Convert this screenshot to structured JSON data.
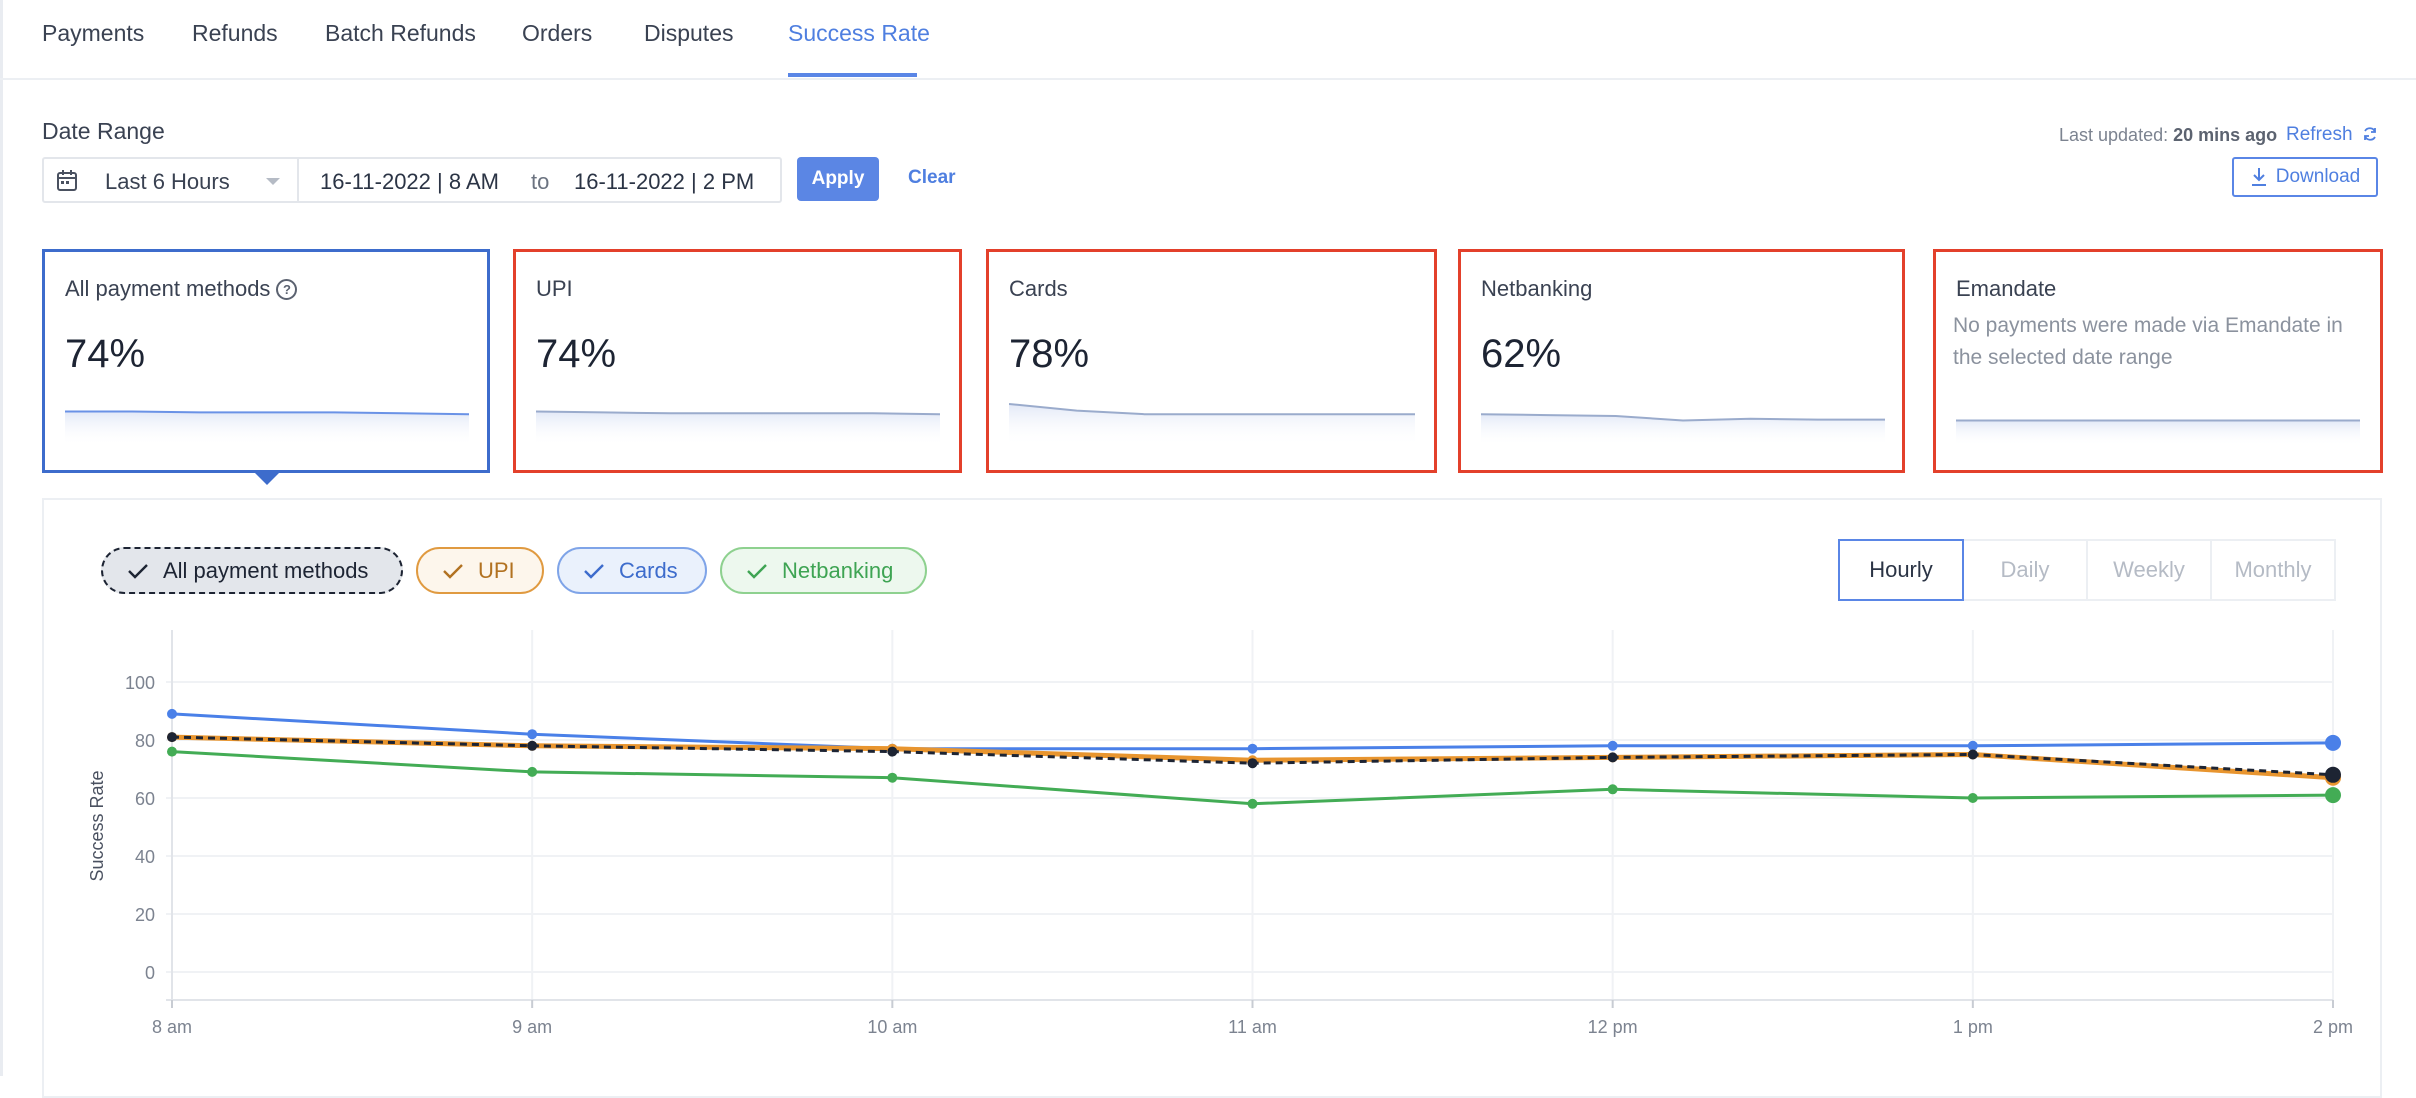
{
  "tabs": [
    {
      "label": "Payments"
    },
    {
      "label": "Refunds"
    },
    {
      "label": "Batch Refunds"
    },
    {
      "label": "Orders"
    },
    {
      "label": "Disputes"
    },
    {
      "label": "Success Rate",
      "active": true
    }
  ],
  "date_range": {
    "label": "Date Range",
    "preset": "Last 6 Hours",
    "from": "16-11-2022 | 8 AM",
    "to_label": "to",
    "to": "16-11-2022 | 2 PM",
    "apply_label": "Apply",
    "clear_label": "Clear"
  },
  "status": {
    "last_updated_prefix": "Last updated:",
    "last_updated_value": "20 mins ago",
    "refresh_label": "Refresh",
    "download_label": "Download"
  },
  "cards": [
    {
      "title": "All payment methods",
      "value": "74%",
      "help_icon": "question-circle-icon",
      "trend": [
        80,
        80,
        79,
        79,
        79,
        78,
        77
      ]
    },
    {
      "title": "UPI",
      "value": "74%",
      "trend": [
        80,
        79,
        78,
        78,
        78,
        78,
        77
      ]
    },
    {
      "title": "Cards",
      "value": "78%",
      "trend": [
        89,
        81,
        77,
        77,
        77,
        77,
        77
      ]
    },
    {
      "title": "Netbanking",
      "value": "62%",
      "trend": [
        77,
        76,
        75,
        70,
        72,
        71,
        71
      ]
    },
    {
      "title": "Emandate",
      "value": "",
      "message": "No payments were made via Emandate in the selected date range",
      "trend": [
        70,
        70,
        70,
        70,
        70,
        70,
        70
      ]
    }
  ],
  "filters": [
    {
      "label": "All payment methods",
      "icon": "check-icon"
    },
    {
      "label": "UPI",
      "icon": "check-icon"
    },
    {
      "label": "Cards",
      "icon": "check-icon"
    },
    {
      "label": "Netbanking",
      "icon": "check-icon"
    }
  ],
  "granularity": {
    "options": [
      "Hourly",
      "Daily",
      "Weekly",
      "Monthly"
    ],
    "selected": "Hourly"
  },
  "colors": {
    "all": "#1d2433",
    "upi": "#e8952f",
    "cards": "#4a80e8",
    "netbanking": "#43ac55",
    "accent": "#4f7fe0",
    "card_alert_border": "#e3402b"
  },
  "chart_data": {
    "type": "line",
    "x": [
      "8 am",
      "9 am",
      "10 am",
      "11 am",
      "12 pm",
      "1 pm",
      "2 pm"
    ],
    "ylabel": "Success Rate",
    "xlabel": "",
    "ylim": [
      -10,
      110
    ],
    "yticks": [
      0,
      20,
      40,
      60,
      80,
      100
    ],
    "grid": true,
    "series": [
      {
        "key": "cards",
        "values": [
          89,
          82,
          77,
          77,
          78,
          78,
          79
        ]
      },
      {
        "key": "upi",
        "values": [
          81,
          78,
          77,
          73,
          74,
          75,
          67
        ]
      },
      {
        "key": "all",
        "values": [
          81,
          78,
          76,
          72,
          74,
          75,
          68
        ]
      },
      {
        "key": "netbanking",
        "values": [
          76,
          69,
          67,
          58,
          63,
          60,
          61
        ]
      }
    ]
  }
}
